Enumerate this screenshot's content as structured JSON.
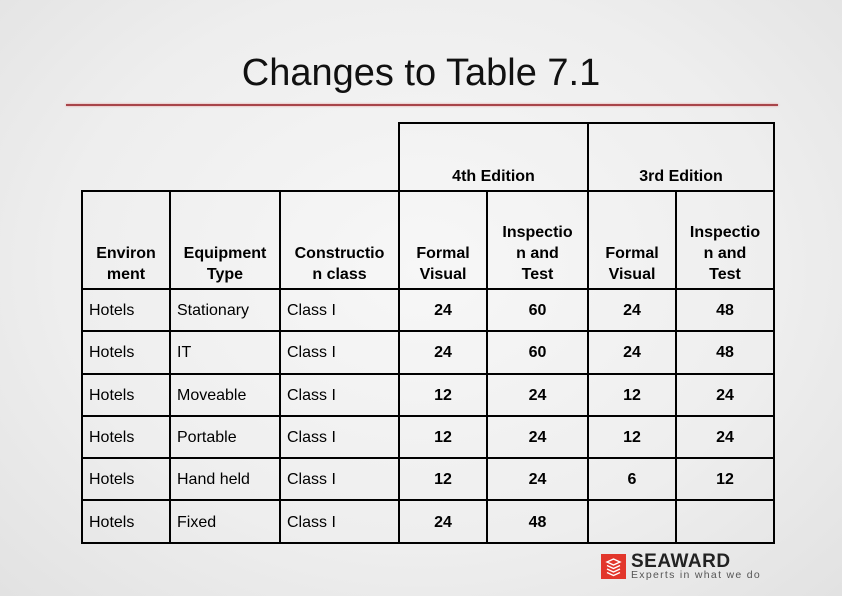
{
  "slide": {
    "title": "Changes to Table 7.1"
  },
  "table": {
    "edition_headers": [
      "4th Edition",
      "3rd Edition"
    ],
    "column_headers": [
      "Environ ment",
      "Equipment Type",
      "Constructio n class",
      "Formal Visual",
      "Inspectio n and Test",
      "Formal Visual",
      "Inspectio n and Test"
    ],
    "column_headers_lines": [
      [
        "Environ",
        "ment"
      ],
      [
        "Equipment",
        "Type"
      ],
      [
        "Constructio",
        "n class"
      ],
      [
        "Formal",
        "Visual"
      ],
      [
        "Inspectio",
        "n and",
        "Test"
      ],
      [
        "Formal",
        "Visual"
      ],
      [
        "Inspectio",
        "n and",
        "Test"
      ]
    ],
    "rows": [
      [
        "Hotels",
        "Stationary",
        "Class I",
        "24",
        "60",
        "24",
        "48"
      ],
      [
        "Hotels",
        "IT",
        "Class I",
        "24",
        "60",
        "24",
        "48"
      ],
      [
        "Hotels",
        "Moveable",
        "Class I",
        "12",
        "24",
        "12",
        "24"
      ],
      [
        "Hotels",
        "Portable",
        "Class I",
        "12",
        "24",
        "12",
        "24"
      ],
      [
        "Hotels",
        "Hand held",
        "Class I",
        "12",
        "24",
        "6",
        "12"
      ],
      [
        "Hotels",
        "Fixed",
        "Class I",
        "24",
        "48",
        "",
        ""
      ]
    ]
  },
  "logo": {
    "icon": "seaward-logo-icon",
    "name": "SEAWARD",
    "tagline": "Experts in what we do",
    "brand_color": "#e2362b"
  },
  "colors": {
    "title_rule": "#a8454a"
  }
}
